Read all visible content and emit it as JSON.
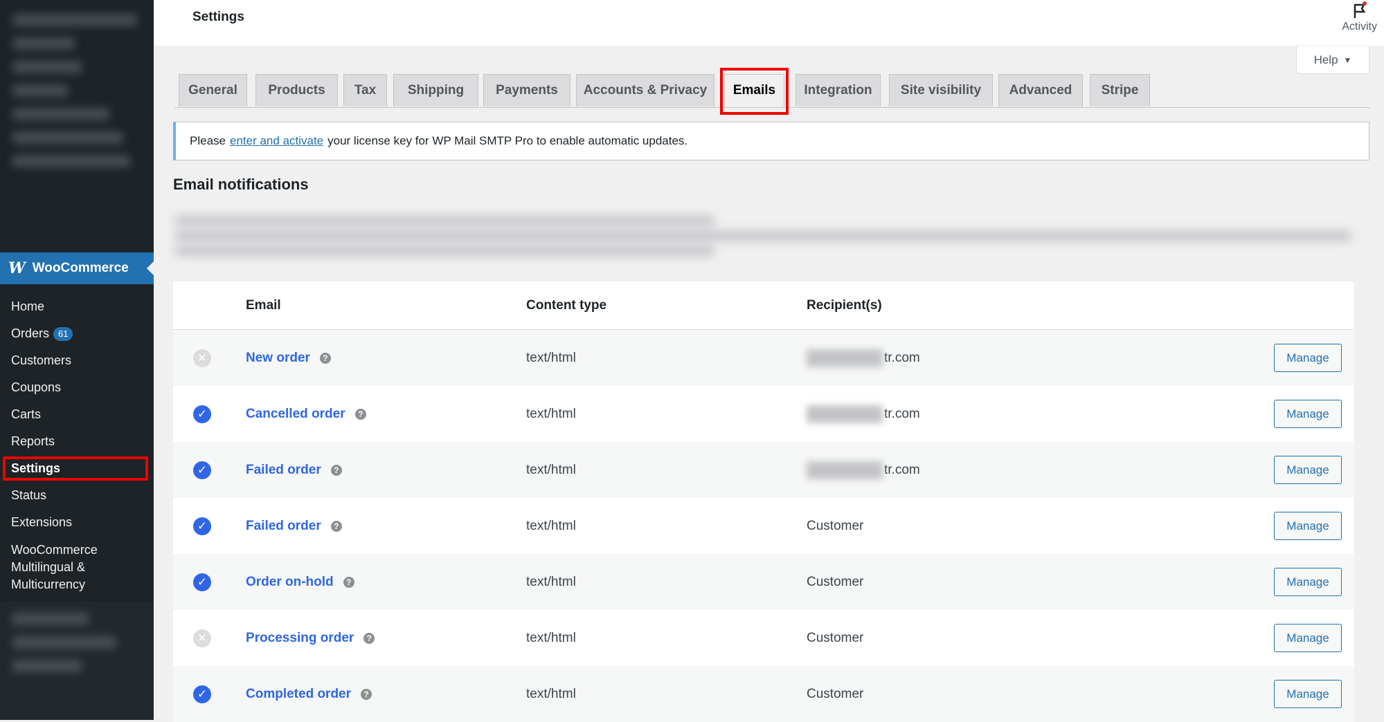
{
  "header": {
    "title": "Settings",
    "activity_label": "Activity",
    "help_label": "Help"
  },
  "sidebar": {
    "brand": "WooCommerce",
    "items": [
      {
        "label": "Home"
      },
      {
        "label": "Orders",
        "badge": "61"
      },
      {
        "label": "Customers"
      },
      {
        "label": "Coupons"
      },
      {
        "label": "Carts"
      },
      {
        "label": "Reports"
      },
      {
        "label": "Settings",
        "active": true
      },
      {
        "label": "Status"
      },
      {
        "label": "Extensions"
      },
      {
        "label": "WooCommerce Multilingual & Multicurrency"
      }
    ]
  },
  "tabs": [
    {
      "label": "General"
    },
    {
      "label": "Products"
    },
    {
      "label": "Tax"
    },
    {
      "label": "Shipping"
    },
    {
      "label": "Payments"
    },
    {
      "label": "Accounts & Privacy"
    },
    {
      "label": "Emails",
      "active": true
    },
    {
      "label": "Integration"
    },
    {
      "label": "Site visibility"
    },
    {
      "label": "Advanced"
    },
    {
      "label": "Stripe"
    }
  ],
  "notice": {
    "prefix": "Please",
    "link": "enter and activate",
    "suffix": "your license key for WP Mail SMTP Pro to enable automatic updates."
  },
  "section_title": "Email notifications",
  "table": {
    "headers": {
      "email": "Email",
      "content_type": "Content type",
      "recipients": "Recipient(s)"
    },
    "manage_label": "Manage",
    "rows": [
      {
        "enabled": false,
        "name": "New order",
        "content_type": "text/html",
        "recipient": "tr.com",
        "recipient_blurred": true
      },
      {
        "enabled": true,
        "name": "Cancelled order",
        "content_type": "text/html",
        "recipient": "tr.com",
        "recipient_blurred": true
      },
      {
        "enabled": true,
        "name": "Failed order",
        "content_type": "text/html",
        "recipient": "tr.com",
        "recipient_blurred": true
      },
      {
        "enabled": true,
        "name": "Failed order",
        "content_type": "text/html",
        "recipient": "Customer",
        "recipient_blurred": false
      },
      {
        "enabled": true,
        "name": "Order on-hold",
        "content_type": "text/html",
        "recipient": "Customer",
        "recipient_blurred": false
      },
      {
        "enabled": false,
        "name": "Processing order",
        "content_type": "text/html",
        "recipient": "Customer",
        "recipient_blurred": false
      },
      {
        "enabled": true,
        "name": "Completed order",
        "content_type": "text/html",
        "recipient": "Customer",
        "recipient_blurred": false
      }
    ]
  },
  "colors": {
    "accent": "#2271b1",
    "link": "#2e66e6",
    "highlight": "#e00000",
    "sidebar": "#1d2327"
  }
}
